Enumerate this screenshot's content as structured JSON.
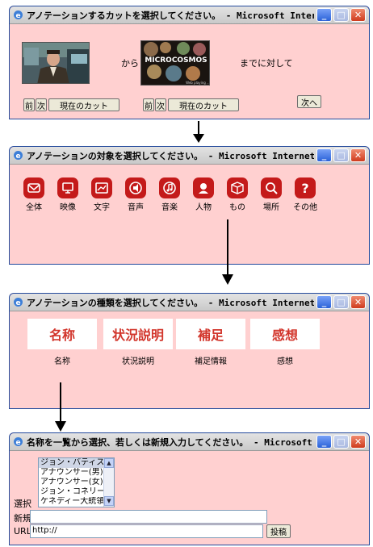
{
  "windows": {
    "cut": {
      "title": "アノテーションするカットを選択してください。 - Microsoft Internet Ex...",
      "thumb_left_alt": "news anchor still",
      "from_label": "から",
      "until_label": "までに対して",
      "thumb_right_text": "MICROCOSMOS",
      "thumb_right_caption": "Web playing ...",
      "left_nav": {
        "prev": "前",
        "next": "次",
        "current": "現在のカット"
      },
      "right_nav": {
        "prev": "前",
        "next": "次",
        "current": "現在のカット"
      },
      "next_button": "次へ"
    },
    "target": {
      "title": "アノテーションの対象を選択してください。 - Microsoft Internet Expl...",
      "icons": [
        {
          "icon": "envelope-icon",
          "label": "全体"
        },
        {
          "icon": "monitor-icon",
          "label": "映像"
        },
        {
          "icon": "picture-icon",
          "label": "文字"
        },
        {
          "icon": "speaker-icon",
          "label": "音声"
        },
        {
          "icon": "music-icon",
          "label": "音楽"
        },
        {
          "icon": "person-icon",
          "label": "人物"
        },
        {
          "icon": "box-icon",
          "label": "もの"
        },
        {
          "icon": "magnifier-icon",
          "label": "場所"
        },
        {
          "icon": "question-icon",
          "label": "その他"
        }
      ]
    },
    "kind": {
      "title": "アノテーションの種類を選択してください。 - Microsoft Internet Expl...",
      "items": [
        {
          "box": "名称",
          "label": "名称"
        },
        {
          "box": "状況説明",
          "label": "状況説明"
        },
        {
          "box": "補足",
          "label": "補足情報"
        },
        {
          "box": "感想",
          "label": "感想"
        }
      ]
    },
    "name": {
      "title": "名称を一覧から選択、若しくは新規入力してください。 - Microsoft In...",
      "select_label": "選択",
      "options": [
        "ジョン・バティスタ",
        "アナウンサー(男)",
        "アナウンサー(女)",
        "ジョン・コネリー",
        "ケネディー大統領"
      ],
      "selected_index": 0,
      "new_label": "新規",
      "new_value": "",
      "url_label": "URL",
      "url_value": "http://",
      "submit": "投稿"
    }
  },
  "colors": {
    "window_bg": "#ffd0d0",
    "icon_red": "#c41a1a",
    "kind_text_red": "#d2352b",
    "frame_blue": "#244a9c"
  }
}
